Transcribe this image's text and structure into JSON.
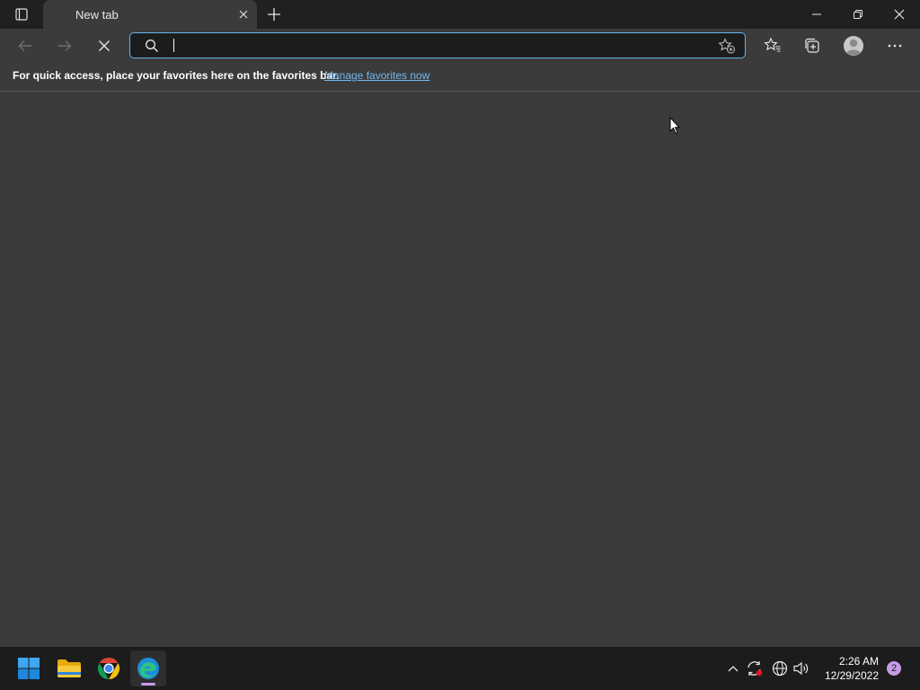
{
  "window": {
    "tab_title": "New tab"
  },
  "toolbar": {
    "address_value": "",
    "address_placeholder": ""
  },
  "favorites_bar": {
    "message": "For quick access, place your favorites here on the favorites bar.",
    "link_text": "Manage favorites now"
  },
  "taskbar": {
    "apps": [
      "start-menu",
      "file-explorer",
      "google-chrome",
      "microsoft-edge"
    ],
    "active_app": "microsoft-edge",
    "clock_time": "2:26 AM",
    "clock_date": "12/29/2022",
    "notification_count": "2"
  },
  "colors": {
    "accent_focus": "#63b4ee",
    "link": "#72b7f2",
    "notification_badge": "#c89be8"
  }
}
